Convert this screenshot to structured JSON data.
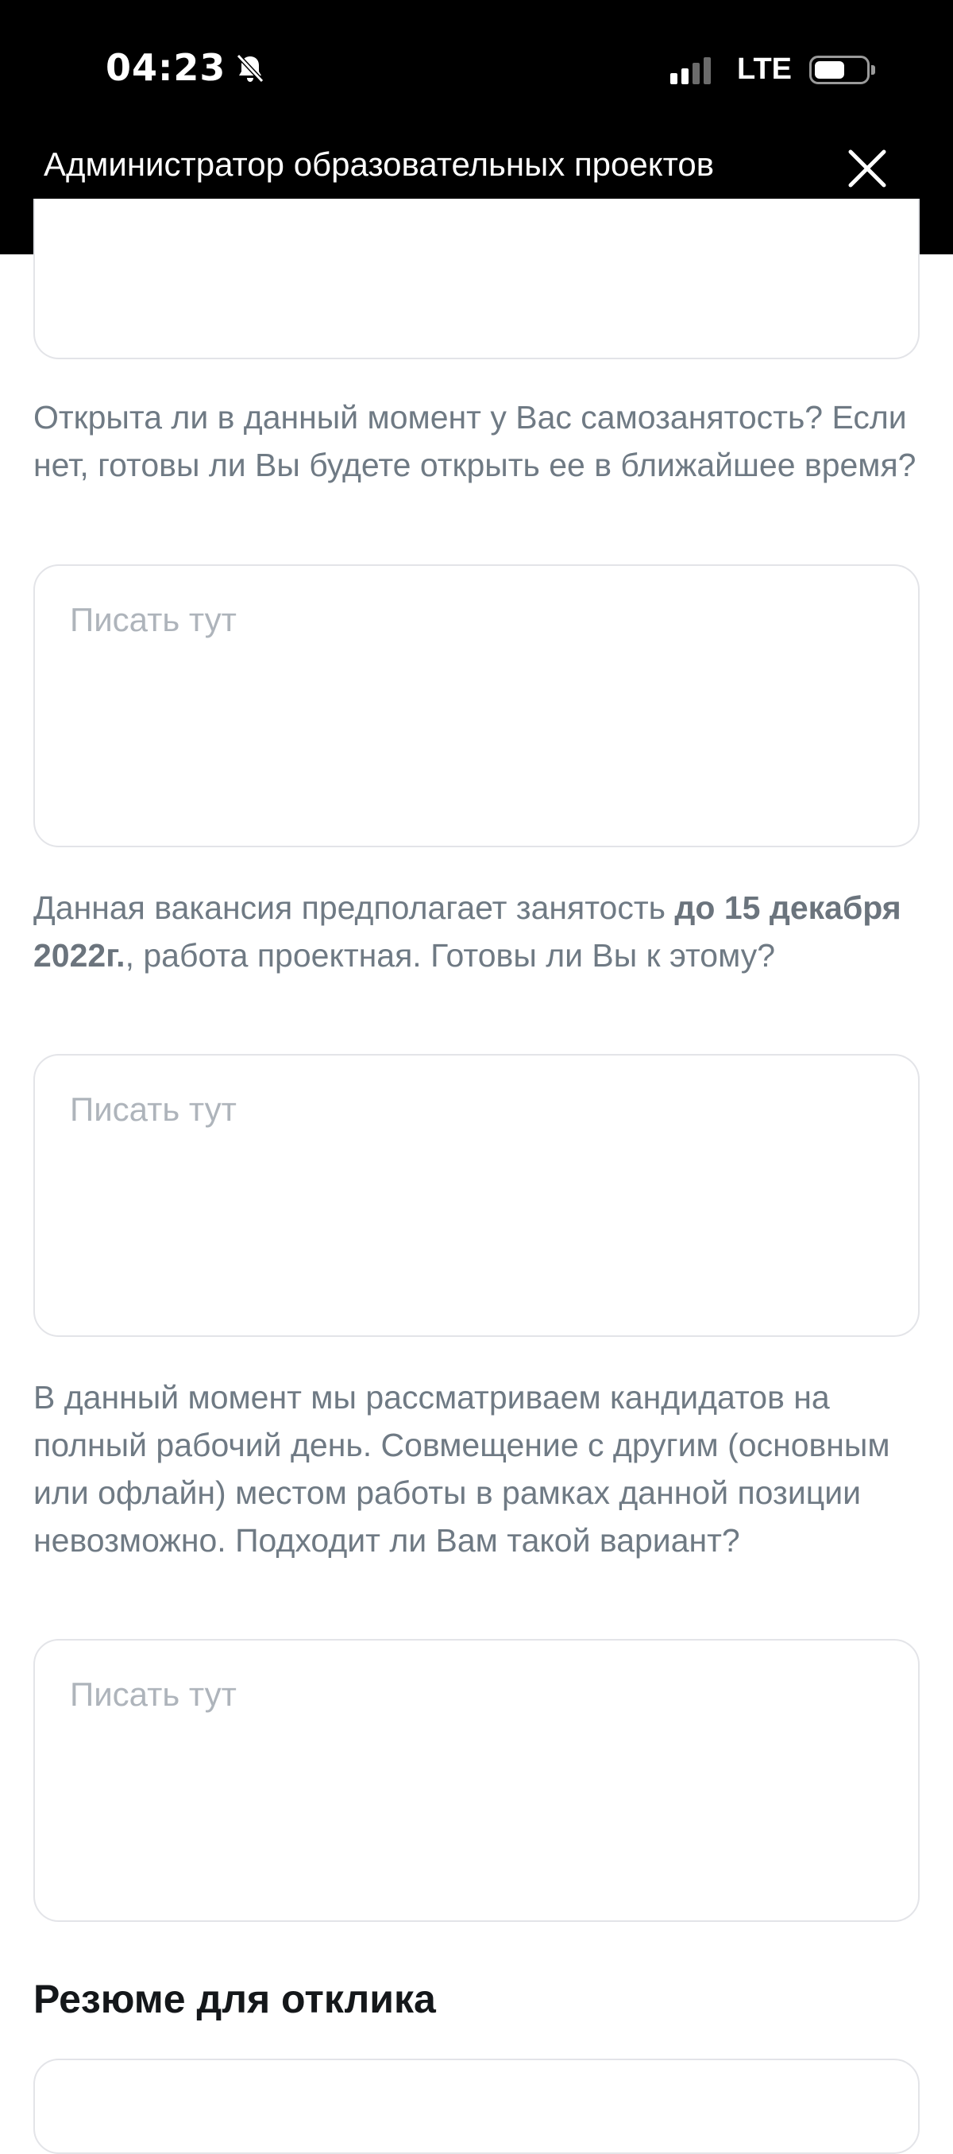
{
  "status_bar": {
    "time": "04:23",
    "network": "LTE",
    "signal_bars_active": 2,
    "signal_bars_total": 4,
    "battery_level": 0.6,
    "silent_icon": "bell-slash-icon"
  },
  "header": {
    "title": "Администратор образовательных проектов",
    "close_icon": "close-icon"
  },
  "questions": [
    {
      "text": "Открыта ли в данный момент у Вас самозанятость? Если нет, готовы ли Вы будете открыть ее в ближайшее время?",
      "placeholder": "Писать тут"
    },
    {
      "text_before": "Данная вакансия предполагает занятость ",
      "text_bold": "до 15 декабря 2022г.",
      "text_after": ", работа проектная. Готовы ли Вы к этому?",
      "placeholder": "Писать тут"
    },
    {
      "text": "В данный момент мы рассматриваем кандидатов на полный рабочий день. Совмещение с другим (основным или офлайн)  местом работы в рамках данной позиции невозможно. Подходит ли Вам такой вариант?",
      "placeholder": "Писать тут"
    }
  ],
  "resume_section": {
    "title": "Резюме для отклика"
  },
  "colors": {
    "header_bg": "#000000",
    "question_text": "#6f7a84",
    "placeholder": "#aeb4bb",
    "border": "#e3e4e8",
    "title_text": "#14171a"
  }
}
